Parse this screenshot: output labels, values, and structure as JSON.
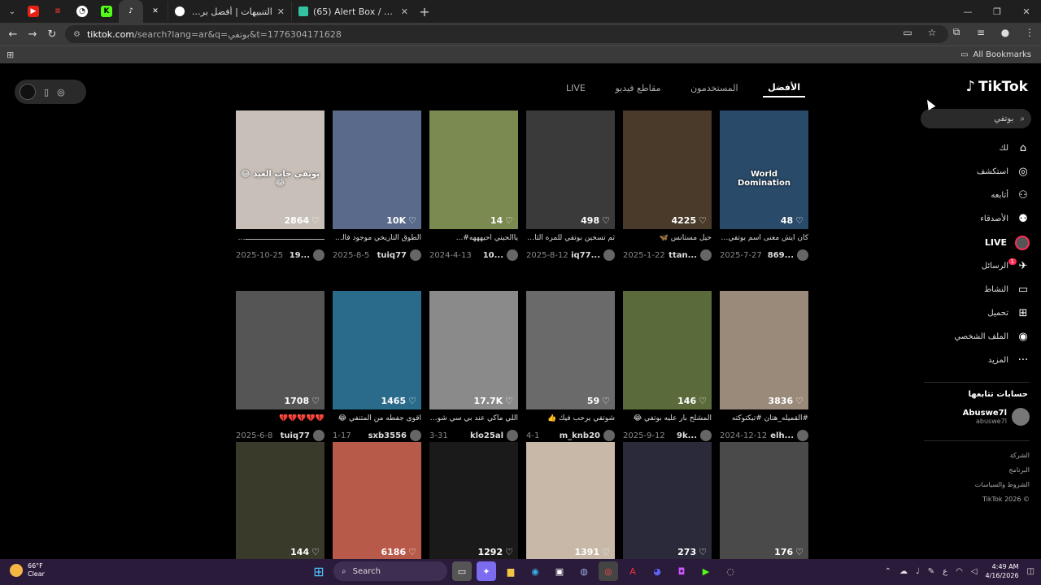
{
  "browser": {
    "tabs": [
      {
        "title": "التنبيهات | أفضل برنامج لتعزيز ال"
      },
      {
        "title": "(65) Alert Box / Streamlabs"
      }
    ],
    "url_host": "tiktok.com",
    "url_rest": "/search?lang=ar&q=بوتفي&t=1776304171628",
    "all_bookmarks": "All Bookmarks"
  },
  "search_tabs": [
    "الأفضل",
    "المستخدمون",
    "مقاطع فيديو",
    "LIVE"
  ],
  "logo": "TikTok",
  "sidebar": {
    "search_query": "بوتفي",
    "items": [
      {
        "label": "لك",
        "icon": "home-icon",
        "glyph": "⌂"
      },
      {
        "label": "استكشف",
        "icon": "compass-icon",
        "glyph": "◎"
      },
      {
        "label": "أتابعه",
        "icon": "user-follow-icon",
        "glyph": "⚇"
      },
      {
        "label": "الأصدقاء",
        "icon": "friends-icon",
        "glyph": "⚉"
      },
      {
        "label": "LIVE",
        "icon": "live-avatar",
        "glyph": ""
      },
      {
        "label": "الرسائل",
        "icon": "messages-icon",
        "glyph": "✈"
      },
      {
        "label": "النشاط",
        "icon": "activity-icon",
        "glyph": "▭"
      },
      {
        "label": "تحميل",
        "icon": "upload-icon",
        "glyph": "⊞"
      },
      {
        "label": "الملف الشخصي",
        "icon": "profile-icon",
        "glyph": "◉"
      },
      {
        "label": "المزيد",
        "icon": "more-icon",
        "glyph": "···"
      }
    ],
    "messages_badge": "1",
    "following_title": "حسابات تتابعها",
    "following": {
      "name": "Abuswe7l",
      "handle": "abuswe7l"
    },
    "footer": [
      "الشركة",
      "البرنامج",
      "الشروط والسياسات",
      "TikTok 2026 ©"
    ]
  },
  "rows": [
    [
      {
        "count": "2864",
        "caption": "ـــــــــــــــــــــــــــــــــــــــــــ",
        "date": "2025-10-25",
        "user": "19...",
        "color": "#c8c0b8",
        "overlay": "بوتفي جاب العيد 😂😂"
      },
      {
        "count": "10K",
        "caption": "الطوق التاريخي موجود فالقنا...",
        "date": "2025-8-5",
        "user": "tuiq77",
        "color": "#5a6a8a",
        "overlay": ""
      },
      {
        "count": "14",
        "caption": "ياالحيني احيهههه#...",
        "date": "2024-4-13",
        "user": "10...",
        "color": "#7a8a50",
        "overlay": ""
      },
      {
        "count": "498",
        "caption": "ثم تسخين بوتفي للمره الثانيه ...",
        "date": "2025-8-12",
        "user": "iq77...",
        "color": "#3a3a3a",
        "overlay": ""
      },
      {
        "count": "4225",
        "caption": "حيل مستانس 🦋",
        "date": "2025-1-22",
        "user": "ttan...",
        "color": "#4a3a2a",
        "overlay": ""
      },
      {
        "count": "48",
        "caption": "كان ايش معنى اسم بوتفي ب...",
        "date": "2025-7-27",
        "user": "869...",
        "color": "#2a4a6a",
        "overlay": "World Domination"
      }
    ],
    [
      {
        "count": "1708",
        "caption": "💔💔💔💔💔",
        "date": "2025-6-8",
        "user": "tuiq77",
        "color": "#555555",
        "overlay": ""
      },
      {
        "count": "1465",
        "caption": "اقوى جفطه من المتنفي 😂",
        "date": "1-17",
        "user": "sxb3556",
        "color": "#2a6a8a",
        "overlay": ""
      },
      {
        "count": "17.7K",
        "caption": "اللي ماكي عند بي سي شوتي...",
        "date": "3-31",
        "user": "klo25al",
        "color": "#8a8a8a",
        "overlay": ""
      },
      {
        "count": "59",
        "caption": "شوتفي يرحب فيك 👍",
        "date": "4-1",
        "user": "m_knb20",
        "color": "#6a6a6a",
        "overlay": ""
      },
      {
        "count": "146",
        "caption": "المشلح بار عليه بوتفي 😂",
        "date": "2025-9-12",
        "user": "9k...",
        "color": "#5a6a3a",
        "overlay": ""
      },
      {
        "count": "3836",
        "caption": "#القميله_هتان #تيكتوكته",
        "date": "2024-12-12",
        "user": "elh...",
        "color": "#9a8a7a",
        "overlay": ""
      }
    ],
    [
      {
        "count": "144",
        "caption": "",
        "date": "",
        "user": "",
        "color": "#3a3a2a",
        "overlay": ""
      },
      {
        "count": "6186",
        "caption": "",
        "date": "",
        "user": "",
        "color": "#b85a4a",
        "overlay": ""
      },
      {
        "count": "1292",
        "caption": "",
        "date": "",
        "user": "",
        "color": "#1a1a1a",
        "overlay": ""
      },
      {
        "count": "1391",
        "caption": "",
        "date": "",
        "user": "",
        "color": "#c8b8a8",
        "overlay": ""
      },
      {
        "count": "273",
        "caption": "",
        "date": "",
        "user": "",
        "color": "#2a2a3a",
        "overlay": ""
      },
      {
        "count": "176",
        "caption": "",
        "date": "",
        "user": "",
        "color": "#4a4a4a",
        "overlay": ""
      }
    ]
  ],
  "taskbar": {
    "temp": "66°F",
    "condition": "Clear",
    "search": "Search",
    "time": "4:49 AM",
    "date": "4/16/2026",
    "lang": "ع"
  }
}
